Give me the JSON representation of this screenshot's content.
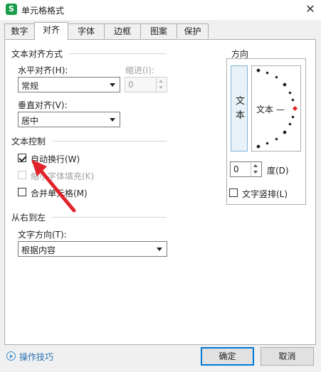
{
  "window": {
    "title": "单元格格式",
    "app_icon_letter": "S"
  },
  "tabs": [
    {
      "label": "数字"
    },
    {
      "label": "对齐"
    },
    {
      "label": "字体"
    },
    {
      "label": "边框"
    },
    {
      "label": "图案"
    },
    {
      "label": "保护"
    }
  ],
  "alignment": {
    "section_title": "文本对齐方式",
    "horizontal_label": "水平对齐(H):",
    "horizontal_value": "常规",
    "indent_label": "缩进(I):",
    "indent_value": "0",
    "vertical_label": "垂直对齐(V):",
    "vertical_value": "居中"
  },
  "text_control": {
    "section_title": "文本控制",
    "wrap_label": "自动换行(W)",
    "wrap_checked": true,
    "shrink_label": "缩小字体填充(K)",
    "merge_label": "合并单元格(M)"
  },
  "rtl": {
    "section_title": "从右到左",
    "direction_label": "文字方向(T):",
    "direction_value": "根据内容"
  },
  "orientation": {
    "section_title": "方向",
    "vertical_text_chars": [
      "文",
      "本"
    ],
    "dial_text": "文本 —",
    "degree_value": "0",
    "degree_label": "度(D)",
    "vertical_stack_label": "文字竖排(L)"
  },
  "footer": {
    "tips_label": "操作技巧",
    "ok_label": "确定",
    "cancel_label": "取消"
  },
  "colors": {
    "accent": "#0078d7",
    "arrow": "#e0242b",
    "brand": "#1a9e4b"
  }
}
